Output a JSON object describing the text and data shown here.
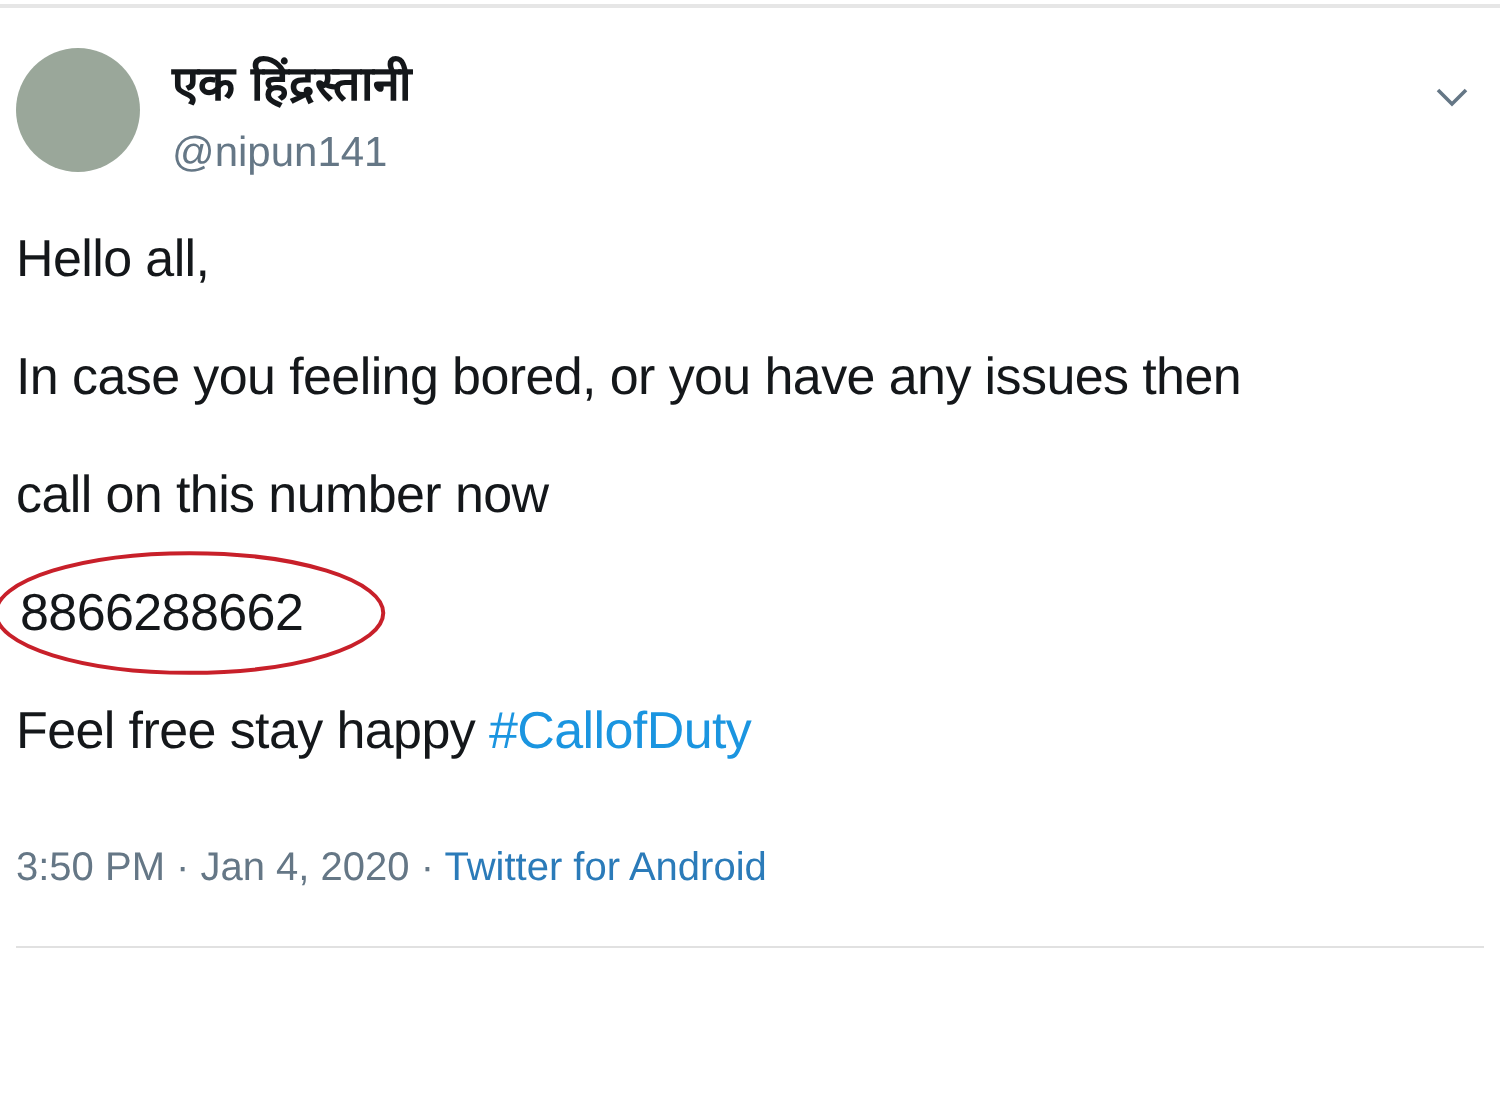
{
  "author": {
    "name": "एक हिंद्रस्तानी",
    "handle": "@nipun141"
  },
  "lines": [
    {
      "text": "Hello all,",
      "circled": false
    },
    {
      "text": "In case you feeling bored, or you have any issues then",
      "circled": false
    },
    {
      "text": "call on this number now",
      "circled": false
    },
    {
      "text": "8866288662",
      "circled": true
    },
    {
      "text": "Feel free stay happy",
      "hashtag": "#CallofDuty",
      "circled": false
    }
  ],
  "meta": {
    "timestamp": "3:50 PM · Jan 4, 2020 ·",
    "source": "Twitter for Android"
  }
}
